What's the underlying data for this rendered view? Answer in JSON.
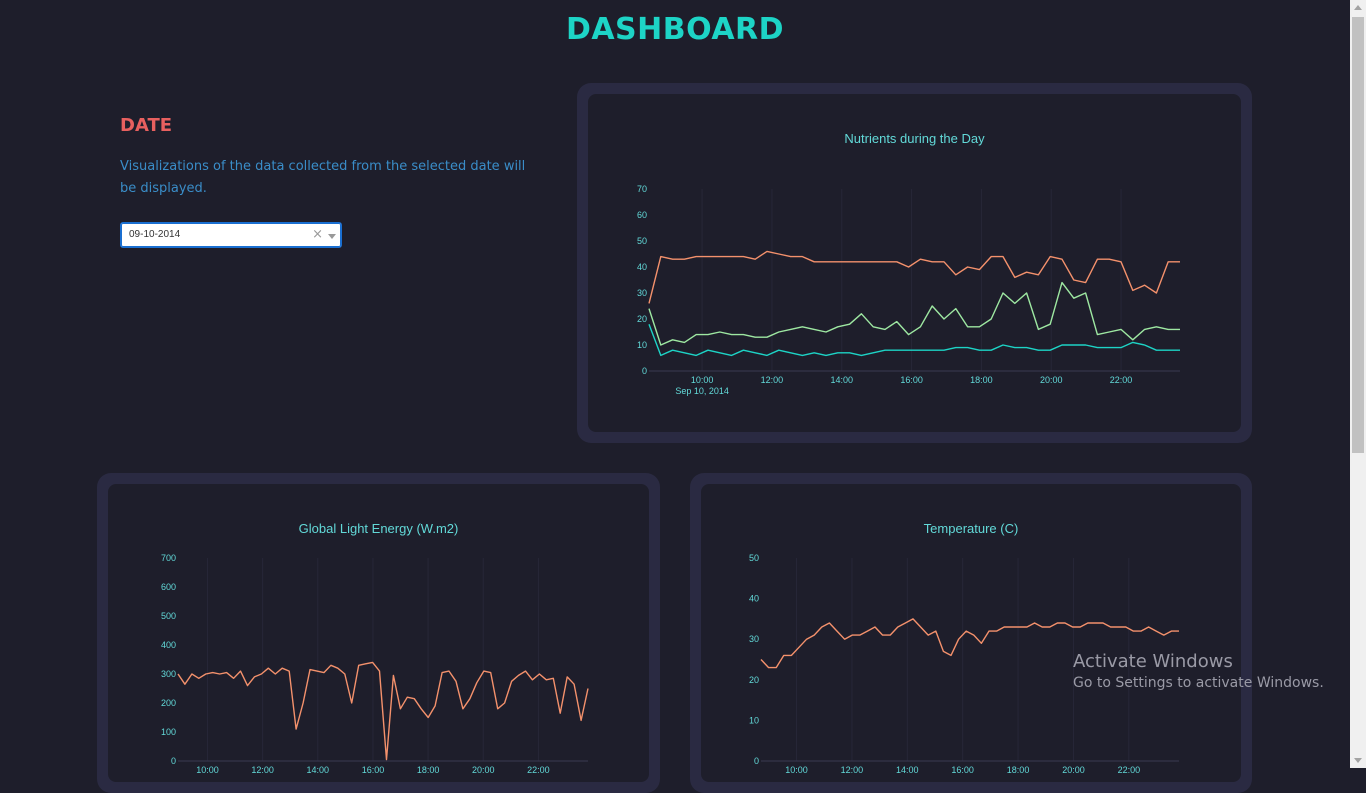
{
  "page": {
    "title": "DASHBOARD"
  },
  "date_panel": {
    "heading": "DATE",
    "description": "Visualizations of the data collected from the selected date will be displayed.",
    "selected_date": "09-10-2014",
    "clear_glyph": "×"
  },
  "colors": {
    "accent": "#1dd4c6",
    "heading_red": "#e8605f",
    "text_blue": "#3a8dc8",
    "card_border": "#2a2a42",
    "background": "#1e1e2b",
    "series_orange": "#f4916c",
    "series_green": "#9ee8a2",
    "series_cyan": "#1dd4c6"
  },
  "chart_data": [
    {
      "type": "line",
      "title": "Nutrients during the Day",
      "x": [
        "08:40",
        "09:00",
        "09:20",
        "09:40",
        "10:00",
        "10:20",
        "10:40",
        "11:00",
        "11:20",
        "11:40",
        "12:00",
        "12:20",
        "12:40",
        "13:00",
        "13:20",
        "13:40",
        "14:00",
        "14:20",
        "14:40",
        "15:00",
        "15:20",
        "15:40",
        "16:00",
        "16:20",
        "16:40",
        "17:00",
        "17:20",
        "17:40",
        "18:00",
        "18:20",
        "18:40",
        "19:00",
        "19:20",
        "19:40",
        "20:00",
        "20:20",
        "20:40",
        "21:00",
        "21:20",
        "21:40",
        "22:00",
        "22:20",
        "22:40",
        "23:00",
        "23:20",
        "23:40"
      ],
      "x_ticks": [
        "10:00",
        "12:00",
        "14:00",
        "16:00",
        "18:00",
        "20:00",
        "22:00"
      ],
      "x_sublabel": "Sep 10, 2014",
      "ylim": [
        0,
        70
      ],
      "y_ticks": [
        0,
        10,
        20,
        30,
        40,
        50,
        60,
        70
      ],
      "series": [
        {
          "color": "#f4916c",
          "values": [
            26,
            44,
            43,
            43,
            44,
            44,
            44,
            44,
            44,
            43,
            46,
            45,
            44,
            44,
            42,
            42,
            42,
            42,
            42,
            42,
            42,
            42,
            40,
            43,
            42,
            42,
            37,
            40,
            39,
            44,
            44,
            36,
            38,
            37,
            44,
            43,
            35,
            34,
            43,
            43,
            42,
            31,
            33,
            30,
            42,
            42
          ]
        },
        {
          "color": "#9ee8a2",
          "values": [
            24,
            10,
            12,
            11,
            14,
            14,
            15,
            14,
            14,
            13,
            13,
            15,
            16,
            17,
            16,
            15,
            17,
            18,
            22,
            17,
            16,
            19,
            14,
            17,
            25,
            20,
            24,
            17,
            17,
            20,
            30,
            26,
            30,
            16,
            18,
            34,
            28,
            30,
            14,
            15,
            16,
            12,
            16,
            17,
            16,
            16
          ]
        },
        {
          "color": "#1dd4c6",
          "values": [
            18,
            6,
            8,
            7,
            6,
            8,
            7,
            6,
            8,
            7,
            6,
            8,
            7,
            6,
            7,
            6,
            7,
            7,
            6,
            7,
            8,
            8,
            8,
            8,
            8,
            8,
            9,
            9,
            8,
            8,
            10,
            9,
            9,
            8,
            8,
            10,
            10,
            10,
            9,
            9,
            9,
            11,
            10,
            8,
            8,
            8
          ]
        }
      ]
    },
    {
      "type": "line",
      "title": "Global Light Energy (W.m2)",
      "x_ticks": [
        "10:00",
        "12:00",
        "14:00",
        "16:00",
        "18:00",
        "20:00",
        "22:00"
      ],
      "ylim": [
        0,
        700
      ],
      "y_ticks": [
        0,
        100,
        200,
        300,
        400,
        500,
        600,
        700
      ],
      "series": [
        {
          "color": "#f4916c",
          "values": [
            300,
            265,
            300,
            285,
            300,
            305,
            300,
            305,
            285,
            310,
            260,
            290,
            300,
            320,
            300,
            320,
            310,
            110,
            200,
            315,
            310,
            305,
            330,
            320,
            300,
            200,
            330,
            335,
            340,
            310,
            5,
            295,
            180,
            220,
            215,
            180,
            150,
            190,
            305,
            310,
            275,
            180,
            215,
            270,
            310,
            305,
            180,
            200,
            275,
            295,
            310,
            280,
            300,
            280,
            285,
            165,
            290,
            265,
            140,
            250
          ]
        }
      ]
    },
    {
      "type": "line",
      "title": "Temperature (C)",
      "x_ticks": [
        "10:00",
        "12:00",
        "14:00",
        "16:00",
        "18:00",
        "20:00",
        "22:00"
      ],
      "ylim": [
        0,
        50
      ],
      "y_ticks": [
        0,
        10,
        20,
        30,
        40,
        50
      ],
      "series": [
        {
          "color": "#f4916c",
          "values": [
            25,
            23,
            23,
            26,
            26,
            28,
            30,
            31,
            33,
            34,
            32,
            30,
            31,
            31,
            32,
            33,
            31,
            31,
            33,
            34,
            35,
            33,
            31,
            32,
            27,
            26,
            30,
            32,
            31,
            29,
            32,
            32,
            33,
            33,
            33,
            33,
            34,
            33,
            33,
            34,
            34,
            33,
            33,
            34,
            34,
            34,
            33,
            33,
            33,
            32,
            32,
            33,
            32,
            31,
            32,
            32
          ]
        }
      ]
    }
  ],
  "os_watermark": {
    "line1": "Activate Windows",
    "line2": "Go to Settings to activate Windows."
  }
}
